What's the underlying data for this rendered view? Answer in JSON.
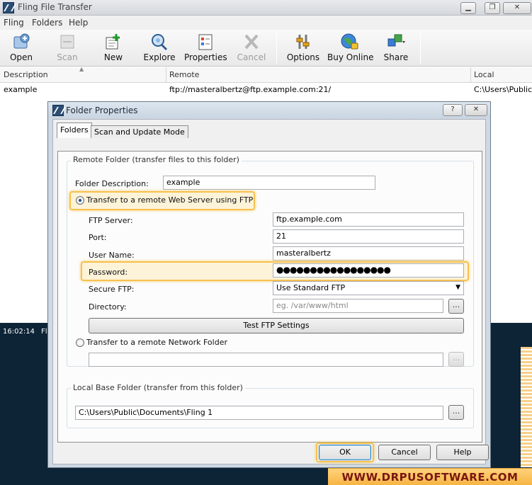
{
  "window": {
    "title": "Fling File Transfer"
  },
  "menu": [
    "Fling",
    "Folders",
    "Help"
  ],
  "toolbar": {
    "open": "Open",
    "scan": "Scan",
    "new": "New",
    "explore": "Explore",
    "properties": "Properties",
    "cancel": "Cancel",
    "options": "Options",
    "buy_online": "Buy Online",
    "share": "Share"
  },
  "list": {
    "columns": [
      "Description",
      "Remote",
      "Local"
    ],
    "rows": [
      {
        "description": "example",
        "remote": "ftp://masteralbertz@ftp.example.com:21/",
        "local": "C:\\Users\\Public\\"
      }
    ]
  },
  "log": {
    "time": "16:02:14",
    "text": "Fl"
  },
  "dialog": {
    "title": "Folder Properties",
    "help_btn": "?",
    "tabs": [
      "Folders",
      "Scan and Update Mode"
    ],
    "remote_group": "Remote Folder (transfer files to this folder)",
    "folder_description_label": "Folder Description:",
    "folder_description_value": "example",
    "radio_ftp": "Transfer to a remote Web Server using FTP",
    "ftp_server_label": "FTP Server:",
    "ftp_server_value": "ftp.example.com",
    "port_label": "Port:",
    "port_value": "21",
    "username_label": "User Name:",
    "username_value": "masteralbertz",
    "password_label": "Password:",
    "password_value": "●●●●●●●●●●●●●●●●●",
    "secure_ftp_label": "Secure FTP:",
    "secure_ftp_value": "Use Standard FTP",
    "directory_label": "Directory:",
    "directory_placeholder": "eg. /var/www/html",
    "browse": "...",
    "test_ftp": "Test FTP Settings",
    "radio_network": "Transfer to a remote Network Folder",
    "local_group": "Local Base Folder (transfer from this folder)",
    "local_path": "C:\\Users\\Public\\Documents\\Fling 1",
    "ok": "OK",
    "cancel": "Cancel",
    "help": "Help"
  },
  "watermark": "WWW.DRPUSOFTWARE.COM"
}
